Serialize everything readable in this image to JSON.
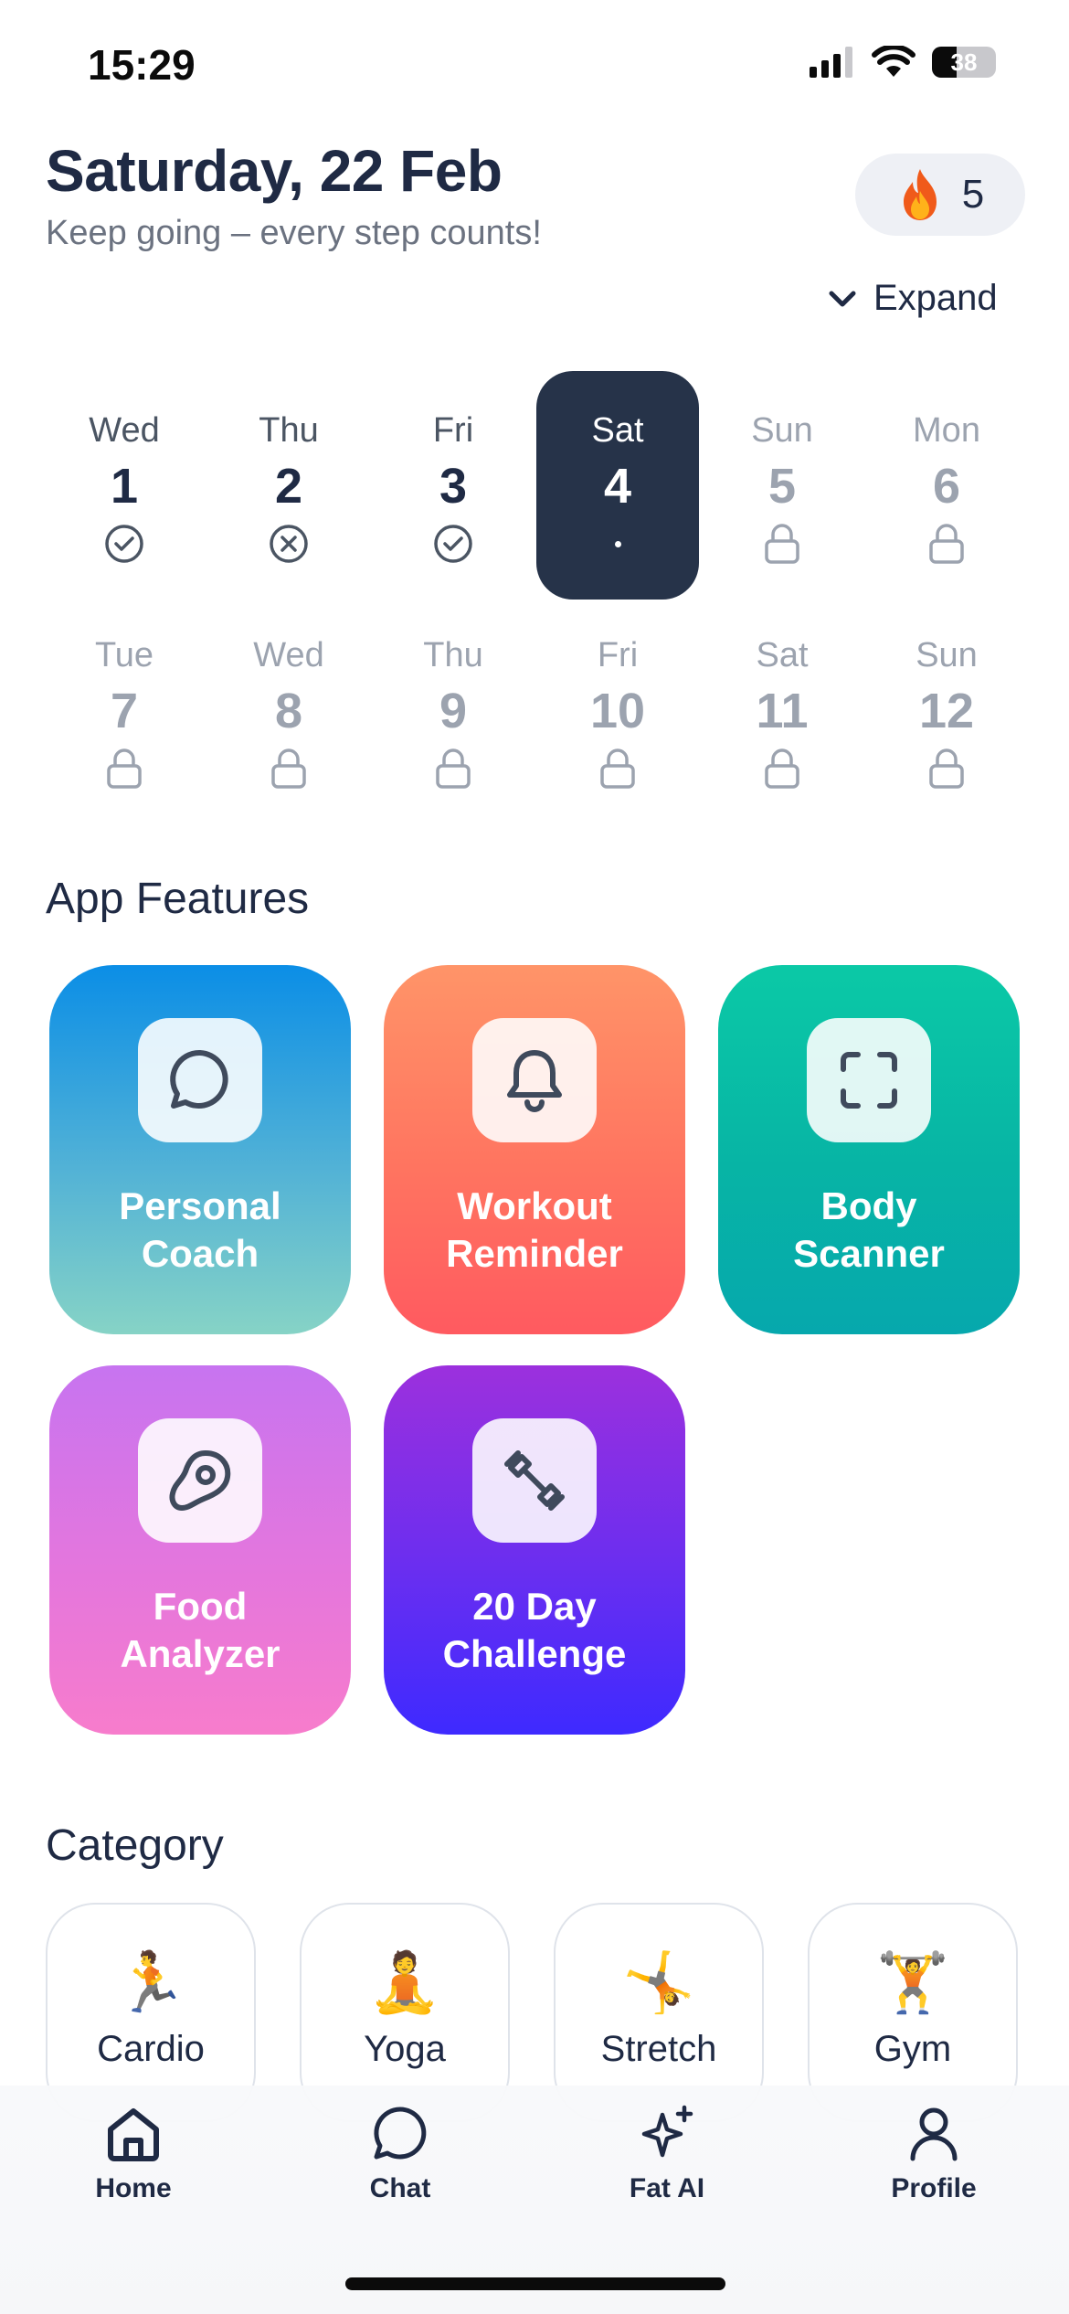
{
  "status_bar": {
    "time": "15:29",
    "battery": "38"
  },
  "header": {
    "date": "Saturday, 22 Feb",
    "subtitle": "Keep going – every step counts!",
    "streak_count": "5",
    "streak_icon": "fire-icon",
    "expand_label": "Expand"
  },
  "calendar": {
    "week1": [
      {
        "day": "Wed",
        "date": "1",
        "status": "done"
      },
      {
        "day": "Thu",
        "date": "2",
        "status": "missed"
      },
      {
        "day": "Fri",
        "date": "3",
        "status": "done"
      },
      {
        "day": "Sat",
        "date": "4",
        "status": "today"
      },
      {
        "day": "Sun",
        "date": "5",
        "status": "locked"
      },
      {
        "day": "Mon",
        "date": "6",
        "status": "locked"
      }
    ],
    "week2": [
      {
        "day": "Tue",
        "date": "7",
        "status": "locked"
      },
      {
        "day": "Wed",
        "date": "8",
        "status": "locked"
      },
      {
        "day": "Thu",
        "date": "9",
        "status": "locked"
      },
      {
        "day": "Fri",
        "date": "10",
        "status": "locked"
      },
      {
        "day": "Sat",
        "date": "11",
        "status": "locked"
      },
      {
        "day": "Sun",
        "date": "12",
        "status": "locked"
      }
    ]
  },
  "features": {
    "title": "App Features",
    "items": [
      {
        "label": "Personal\nCoach",
        "icon": "chat-bubble-icon"
      },
      {
        "label": "Workout\nReminder",
        "icon": "bell-icon"
      },
      {
        "label": "Body\nScanner",
        "icon": "scan-frame-icon"
      },
      {
        "label": "Food\nAnalyzer",
        "icon": "steak-icon"
      },
      {
        "label": "20 Day\nChallenge",
        "icon": "dumbbell-icon"
      }
    ]
  },
  "category": {
    "title": "Category",
    "items": [
      {
        "label": "Cardio",
        "emoji": "🏃"
      },
      {
        "label": "Yoga",
        "emoji": "🧘"
      },
      {
        "label": "Stretch",
        "emoji": "🤸"
      },
      {
        "label": "Gym",
        "emoji": "🏋"
      }
    ]
  },
  "tabs": [
    {
      "label": "Home",
      "icon": "home-icon"
    },
    {
      "label": "Chat",
      "icon": "chat-icon"
    },
    {
      "label": "Fat AI",
      "icon": "sparkles-icon"
    },
    {
      "label": "Profile",
      "icon": "user-icon"
    }
  ]
}
